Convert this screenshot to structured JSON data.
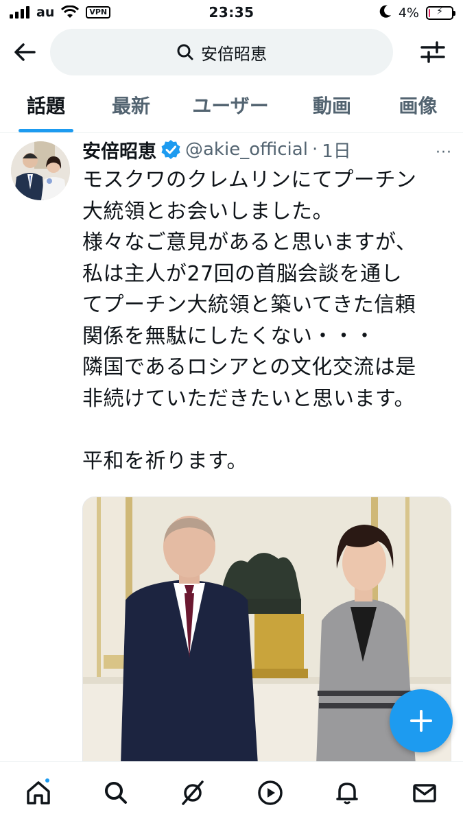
{
  "status_bar": {
    "carrier": "au",
    "vpn": "VPN",
    "time": "23:35",
    "battery_percent": "4%",
    "battery_level": 0.04
  },
  "search": {
    "query": "安倍昭恵"
  },
  "tabs": [
    {
      "label": "話題",
      "active": true
    },
    {
      "label": "最新",
      "active": false
    },
    {
      "label": "ユーザー",
      "active": false
    },
    {
      "label": "動画",
      "active": false
    },
    {
      "label": "画像",
      "active": false
    }
  ],
  "tweet": {
    "display_name": "安倍昭恵",
    "handle": "@akie_official",
    "separator": "·",
    "time": "1日",
    "more": "···",
    "text": "モスクワのクレムリンにてプーチン\n大統領とお会いしました。\n様々なご意見があると思いますが、\n私は主人が27回の首脳会談を通し\nてプーチン大統領と築いてきた信頼\n関係を無駄にしたくない・・・\n隣国であるロシアとの文化交流は是\n非続けていただきたいと思います。\n\n平和を祈ります。"
  },
  "icons": {
    "back": "arrow-left-icon",
    "search": "search-icon",
    "filter": "sliders-icon",
    "verified": "verified-badge-icon",
    "compose": "plus-icon",
    "nav": [
      "home-icon",
      "search-icon",
      "grok-icon",
      "play-icon",
      "bell-icon",
      "mail-icon"
    ]
  },
  "colors": {
    "accent": "#1d9bf0",
    "text": "#0f1419",
    "muted": "#536471",
    "search_bg": "#eff3f4"
  }
}
